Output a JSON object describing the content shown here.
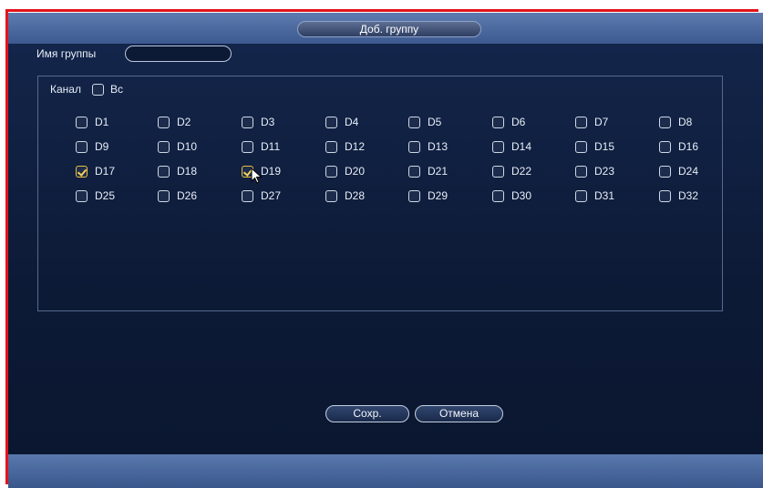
{
  "dialog": {
    "title": "Доб. группу"
  },
  "group_name": {
    "label": "Имя группы",
    "value": ""
  },
  "channel_header": {
    "label": "Канал",
    "all_label": "Вс",
    "all_checked": false
  },
  "channels": [
    {
      "label": "D1",
      "checked": false
    },
    {
      "label": "D2",
      "checked": false
    },
    {
      "label": "D3",
      "checked": false
    },
    {
      "label": "D4",
      "checked": false
    },
    {
      "label": "D5",
      "checked": false
    },
    {
      "label": "D6",
      "checked": false
    },
    {
      "label": "D7",
      "checked": false
    },
    {
      "label": "D8",
      "checked": false
    },
    {
      "label": "D9",
      "checked": false
    },
    {
      "label": "D10",
      "checked": false
    },
    {
      "label": "D11",
      "checked": false
    },
    {
      "label": "D12",
      "checked": false
    },
    {
      "label": "D13",
      "checked": false
    },
    {
      "label": "D14",
      "checked": false
    },
    {
      "label": "D15",
      "checked": false
    },
    {
      "label": "D16",
      "checked": false
    },
    {
      "label": "D17",
      "checked": true
    },
    {
      "label": "D18",
      "checked": false
    },
    {
      "label": "D19",
      "checked": true
    },
    {
      "label": "D20",
      "checked": false
    },
    {
      "label": "D21",
      "checked": false
    },
    {
      "label": "D22",
      "checked": false
    },
    {
      "label": "D23",
      "checked": false
    },
    {
      "label": "D24",
      "checked": false
    },
    {
      "label": "D25",
      "checked": false
    },
    {
      "label": "D26",
      "checked": false
    },
    {
      "label": "D27",
      "checked": false
    },
    {
      "label": "D28",
      "checked": false
    },
    {
      "label": "D29",
      "checked": false
    },
    {
      "label": "D30",
      "checked": false
    },
    {
      "label": "D31",
      "checked": false
    },
    {
      "label": "D32",
      "checked": false
    }
  ],
  "buttons": {
    "save": "Сохр.",
    "cancel": "Отмена"
  },
  "colors": {
    "background": "#0f1d3a",
    "titlebar": "#4d6aa0",
    "checked": "#e9c13b",
    "annotation": "#e3141b"
  }
}
